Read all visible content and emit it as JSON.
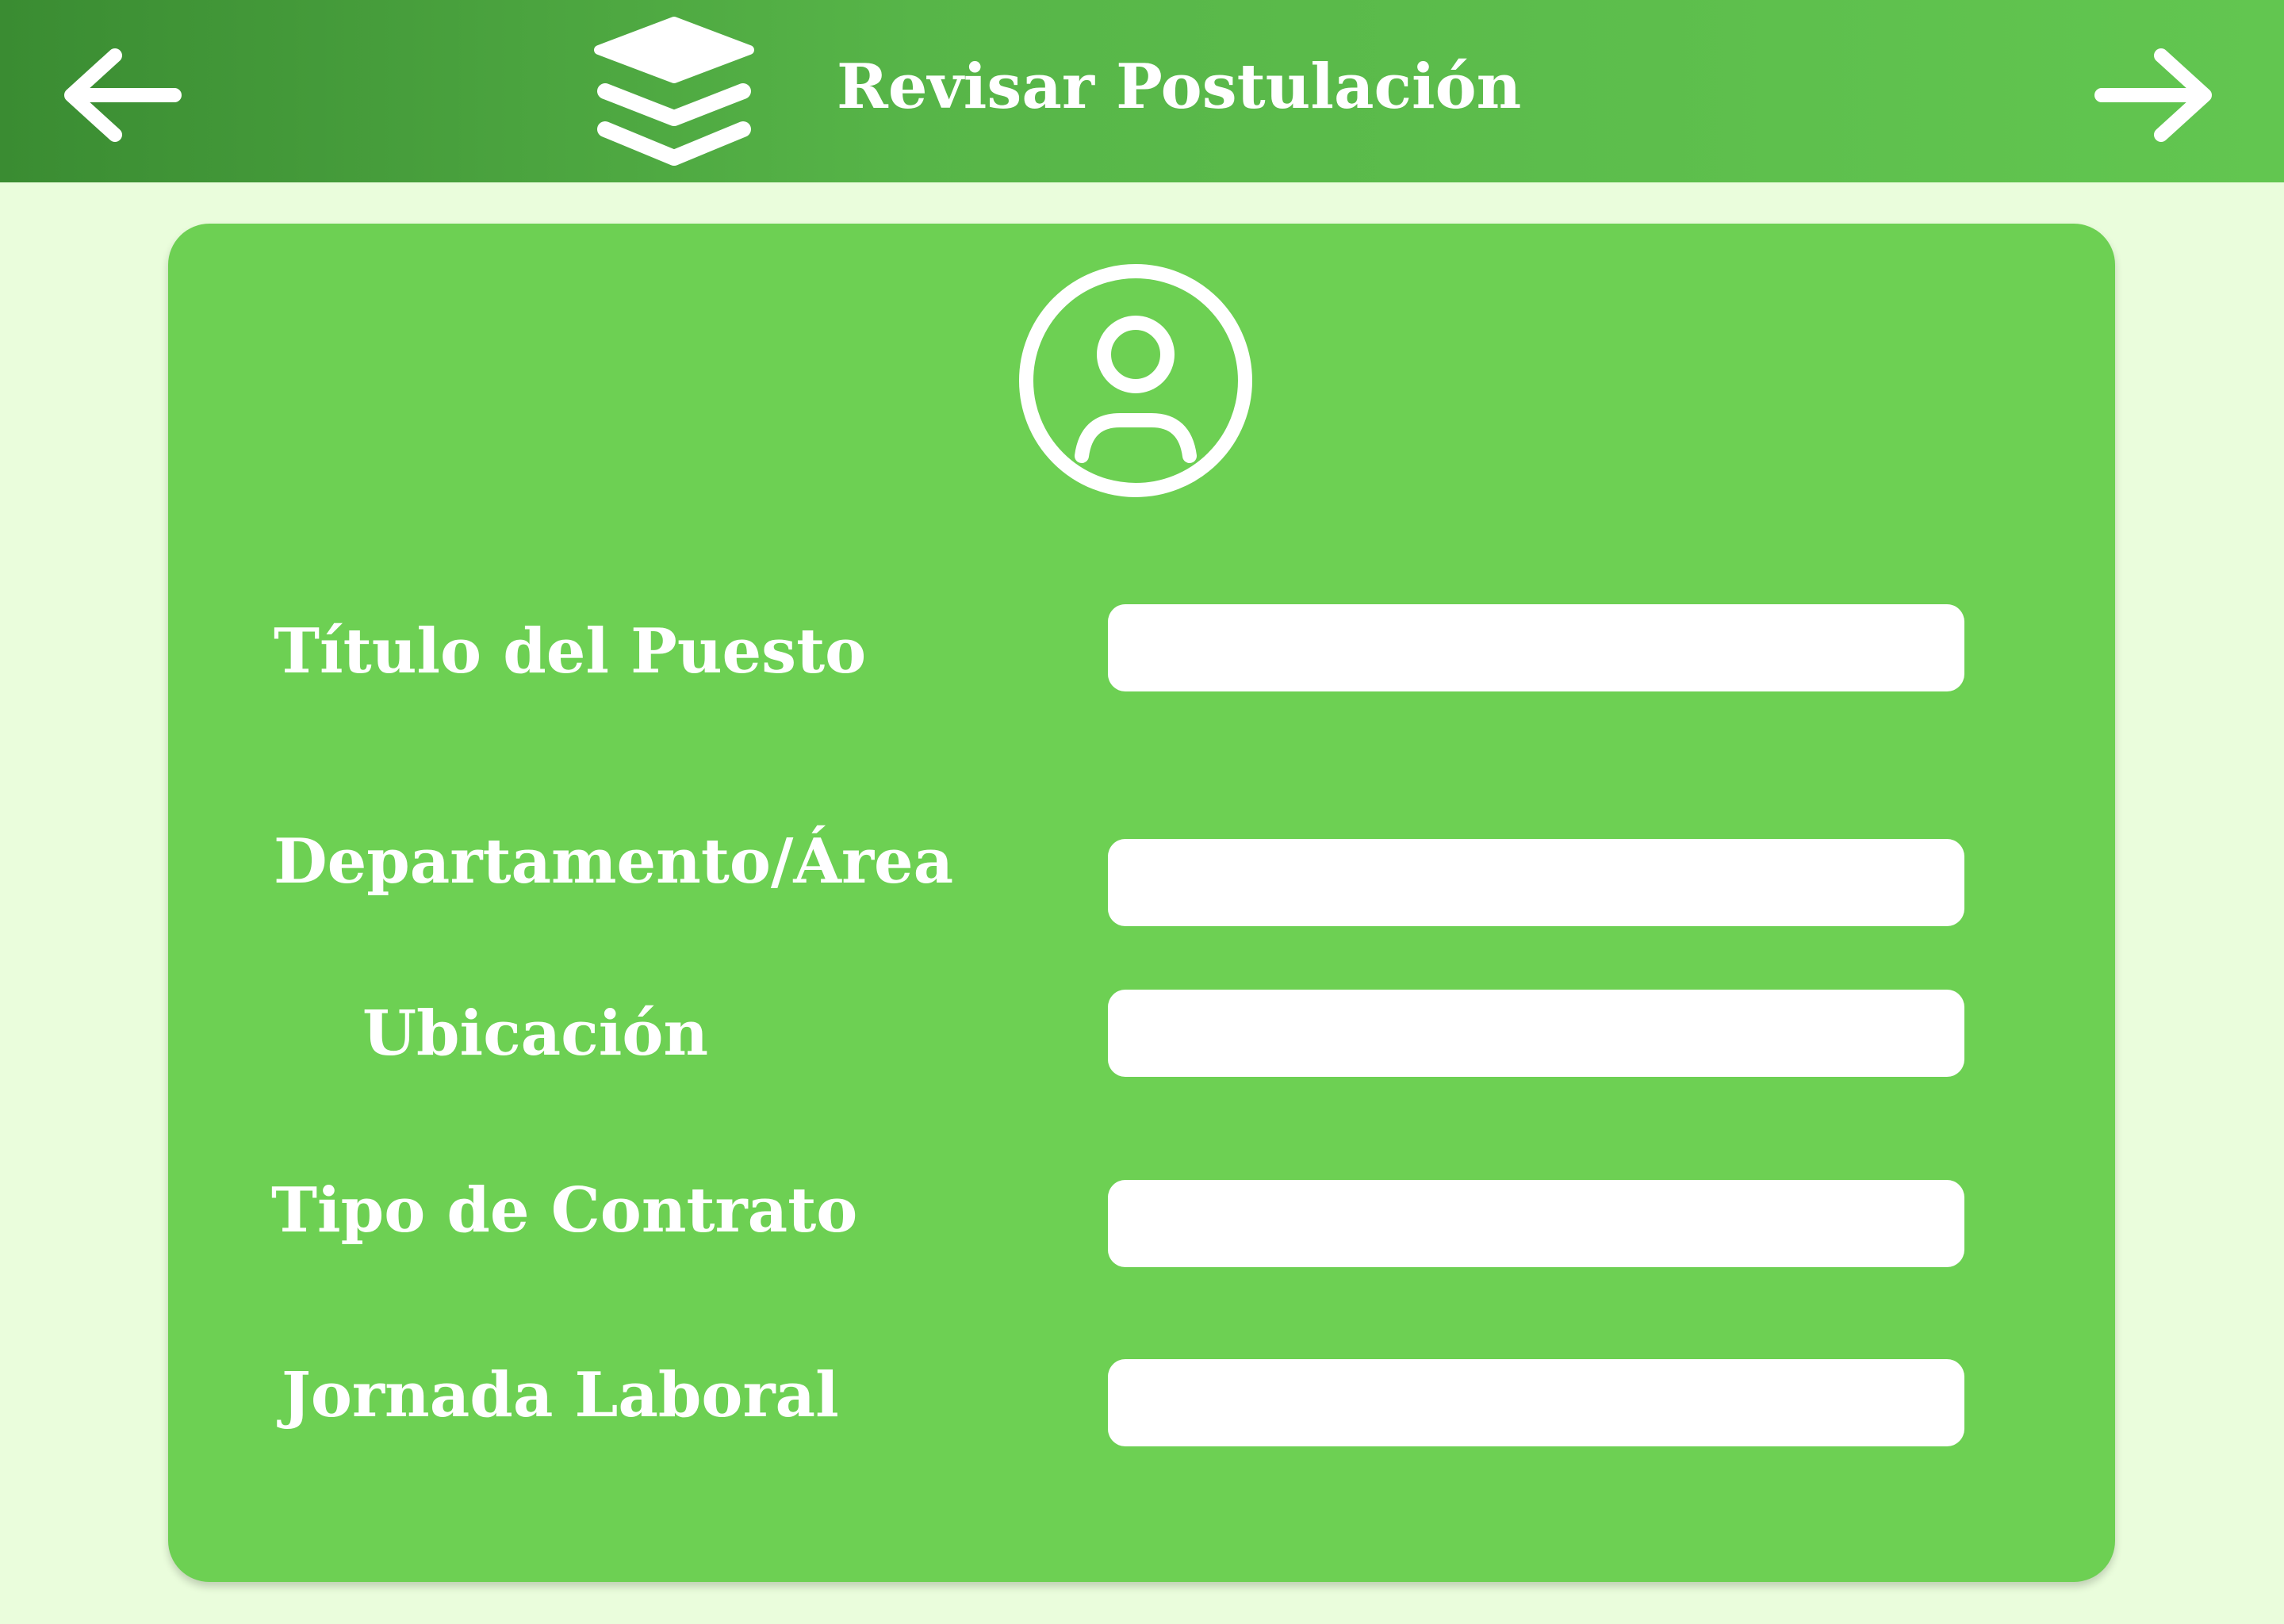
{
  "header": {
    "title": "Revisar Postulación",
    "back_icon": "arrow-left-icon",
    "forward_icon": "arrow-right-icon",
    "logo_icon": "layers-icon"
  },
  "form": {
    "avatar_icon": "user-circle-icon",
    "fields": [
      {
        "label": "Título del Puesto",
        "value": "",
        "placeholder": ""
      },
      {
        "label": "Departamento/Área",
        "value": "",
        "placeholder": ""
      },
      {
        "label": "Ubicación",
        "value": "",
        "placeholder": ""
      },
      {
        "label": "Tipo de Contrato",
        "value": "",
        "placeholder": ""
      },
      {
        "label": "Jornada Laboral",
        "value": "",
        "placeholder": ""
      }
    ]
  },
  "colors": {
    "header_start": "#3a8c32",
    "header_end": "#62c650",
    "card": "#6dd053",
    "page_background": "#eafddc",
    "text": "#ffffff"
  }
}
